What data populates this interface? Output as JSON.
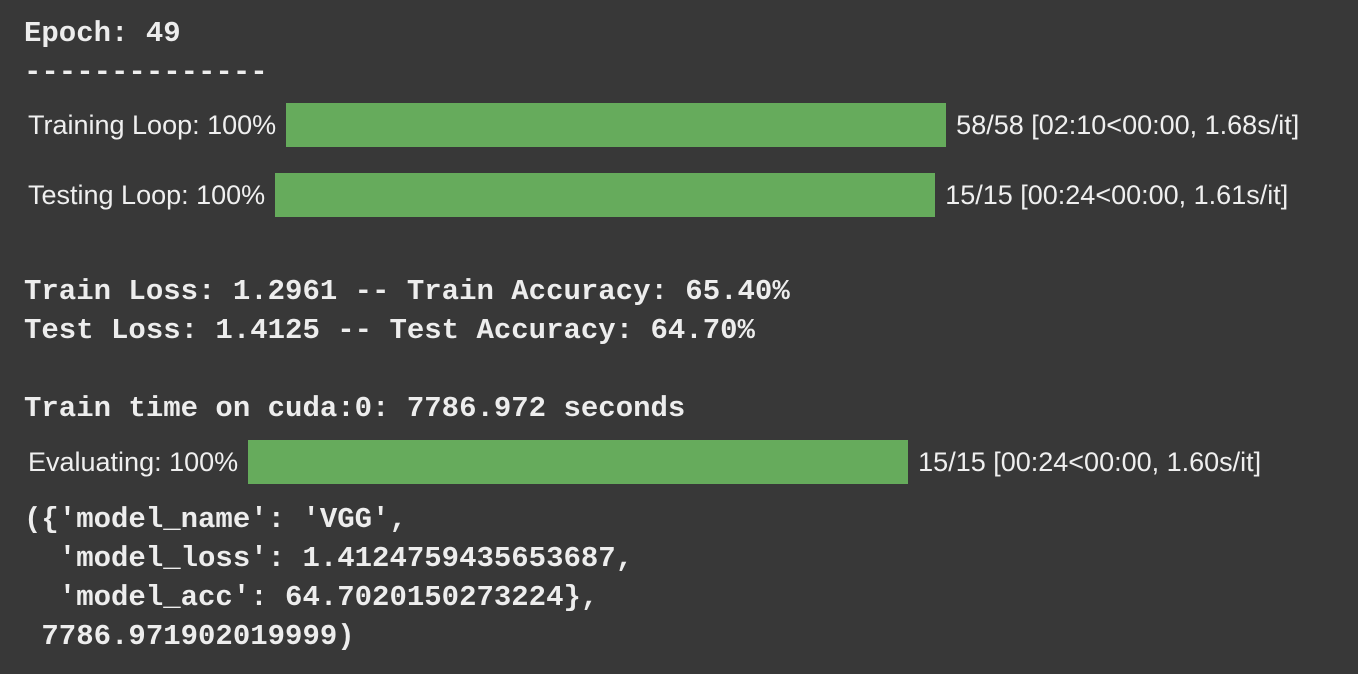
{
  "epoch_line": "Epoch: 49",
  "separator": "--------------",
  "training_loop": {
    "label": "Training Loop: 100%",
    "progress": 1.0,
    "stats": "58/58 [02:10<00:00, 1.68s/it]"
  },
  "testing_loop": {
    "label": "Testing Loop: 100%",
    "progress": 1.0,
    "stats": "15/15 [00:24<00:00, 1.61s/it]"
  },
  "train_metrics": "Train Loss: 1.2961 -- Train Accuracy: 65.40%",
  "test_metrics": "Test Loss: 1.4125 -- Test Accuracy: 64.70%",
  "train_time": "Train time on cuda:0: 7786.972 seconds",
  "evaluating": {
    "label": "Evaluating: 100%",
    "progress": 1.0,
    "stats": "15/15 [00:24<00:00, 1.60s/it]"
  },
  "result_lines": [
    "({'model_name': 'VGG',",
    "  'model_loss': 1.4124759435653687,",
    "  'model_acc': 64.7020150273224},",
    " 7786.971902019999)"
  ],
  "colors": {
    "background": "#383838",
    "bar_fill": "#66ab5c"
  }
}
